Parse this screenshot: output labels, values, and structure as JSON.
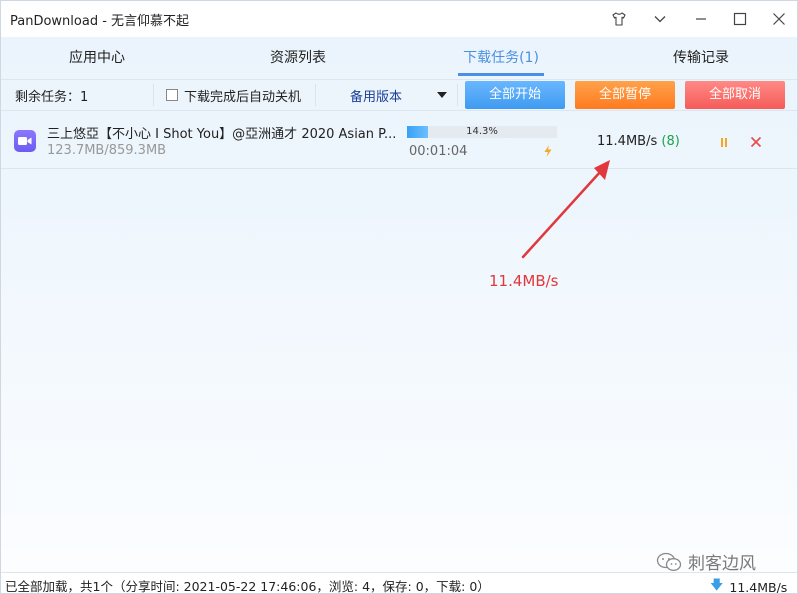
{
  "window": {
    "title": "PanDownload - 无言仰慕不起"
  },
  "tabs": [
    {
      "label": "应用中心",
      "active": false
    },
    {
      "label": "资源列表",
      "active": false
    },
    {
      "label": "下载任务(1)",
      "active": true
    },
    {
      "label": "传输记录",
      "active": false
    }
  ],
  "toolbar": {
    "remaining_tasks": "剩余任务：1",
    "auto_shutdown_label": "下载完成后自动关机",
    "auto_shutdown_checked": false,
    "version_select": "备用版本",
    "start_all": "全部开始",
    "pause_all": "全部暂停",
    "cancel_all": "全部取消"
  },
  "tasks": [
    {
      "name": "三上悠亞【不小心 I Shot You】@亞洲通才 2020 Asian P...",
      "size": "123.7MB/859.3MB",
      "progress_text": "14.3%",
      "progress": 0.143,
      "elapsed": "00:01:04",
      "speed": "11.4MB/s",
      "connections": "(8)"
    }
  ],
  "annotation": {
    "text": "11.4MB/s",
    "color": "#e0383c"
  },
  "watermark": {
    "text": "刺客边风"
  },
  "status": {
    "text": "已全部加载，共1个（分享时间: 2021-05-22 17:46:06，浏览: 4，保存: 0，下载: 0）",
    "total_speed": "11.4MB/s"
  },
  "colors": {
    "accent": "#4a90e2",
    "start_button": "#4aa6f5",
    "pause_button": "#ff8a2f",
    "cancel_button": "#f66a68",
    "speed_connections": "#1aa34a"
  }
}
